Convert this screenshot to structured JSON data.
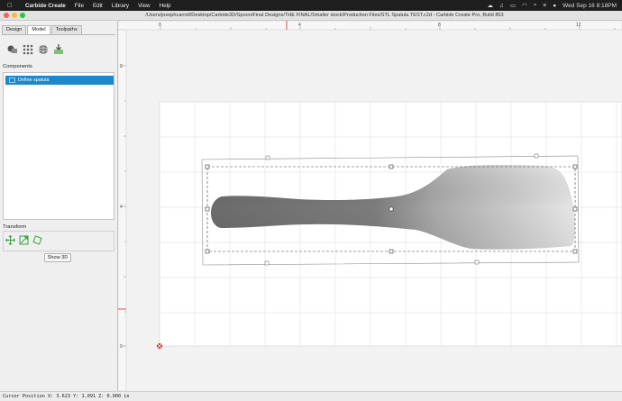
{
  "menubar": {
    "apple": "",
    "app_name": "Carbide Create",
    "menus": [
      "File",
      "Edit",
      "Library",
      "View",
      "Help"
    ],
    "clock": "Wed Sep 16  8:18PM"
  },
  "window": {
    "title": "/Users/josephcarroll/Desktop/Carbide3D/Spoon/Final Designs/THE FINAL/Smaller stock/Production Files/STL Spatula TEST.c2d - Carbide Create Pro, Build 853"
  },
  "panel": {
    "tabs": [
      "Design",
      "Model",
      "Toolpaths"
    ],
    "active_tab": "Model",
    "components_label": "Components",
    "component_items": [
      "Define spatula"
    ],
    "transform_label": "Transform",
    "show3d_label": "Show 3D"
  },
  "ruler": {
    "top_ticks": [
      "0",
      "4",
      "8",
      "12"
    ],
    "left_ticks": [
      "8",
      "4",
      "0"
    ]
  },
  "status": {
    "cursor_text": "Cursor Position X: 3.623 Y: 1.091 Z: 0.000 in"
  },
  "colors": {
    "menubar_bg": "#1e1e1e",
    "selection_blue": "#1d88c9",
    "origin_red": "#e02020"
  }
}
